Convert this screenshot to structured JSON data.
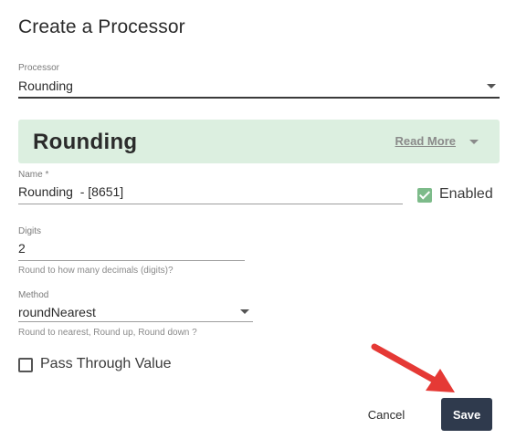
{
  "dialog": {
    "title": "Create a Processor"
  },
  "processor_select": {
    "label": "Processor",
    "value": "Rounding"
  },
  "banner": {
    "title": "Rounding",
    "read_more": "Read More"
  },
  "name_field": {
    "label": "Name *",
    "value": "Rounding  - [8651]"
  },
  "enabled": {
    "label": "Enabled",
    "checked": true
  },
  "digits_field": {
    "label": "Digits",
    "value": "2",
    "helper": "Round to how many decimals (digits)?"
  },
  "method_select": {
    "label": "Method",
    "value": "roundNearest",
    "helper": "Round to nearest, Round up, Round down ?"
  },
  "pass_through": {
    "label": "Pass Through Value",
    "checked": false
  },
  "actions": {
    "cancel": "Cancel",
    "save": "Save"
  },
  "colors": {
    "banner_bg": "#dcefe0",
    "save_bg": "#2f3a4d",
    "check_green": "#7dbb8a",
    "annotation_arrow": "#e53935"
  }
}
